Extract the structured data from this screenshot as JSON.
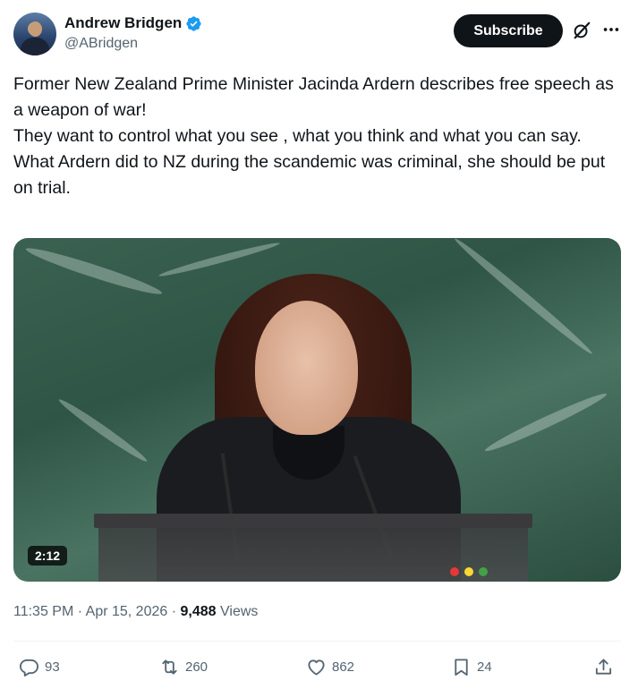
{
  "author": {
    "display_name": "Andrew Bridgen",
    "handle": "@ABridgen",
    "verified_color": "#1d9bf0"
  },
  "header": {
    "subscribe_label": "Subscribe",
    "icons": [
      "grok-icon",
      "more-icon"
    ]
  },
  "tweet": {
    "lines": [
      "Former New Zealand Prime Minister Jacinda Ardern describes free speech as a weapon of war!",
      "They want to control what you see , what you think and what you can say.",
      "What Ardern did to NZ during the scandemic was criminal, she should be put on trial."
    ]
  },
  "media": {
    "duration": "2:12"
  },
  "meta": {
    "time": "11:35 PM",
    "separator": "·",
    "date": "Apr 15, 2026",
    "views_count": "9,488",
    "views_label": "Views"
  },
  "actions": {
    "replies": "93",
    "reposts": "260",
    "likes": "862",
    "bookmarks": "24"
  },
  "colors": {
    "text": "#0f1419",
    "secondary": "#536471",
    "accent": "#1d9bf0"
  }
}
